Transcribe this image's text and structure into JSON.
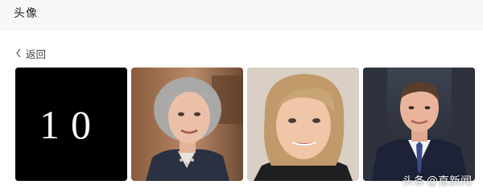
{
  "header": {
    "title": "头像"
  },
  "nav": {
    "back_label": "返回"
  },
  "gallery": {
    "items": [
      {
        "icon": "number-10-logo",
        "text": "10"
      },
      {
        "icon": "portrait-photo"
      },
      {
        "icon": "portrait-photo"
      },
      {
        "icon": "portrait-photo"
      }
    ]
  },
  "watermark": {
    "source": "头条",
    "at": "@",
    "account": "直新闻"
  },
  "colors": {
    "header_bg": "#f7f7f7",
    "logo_bg": "#000000"
  }
}
